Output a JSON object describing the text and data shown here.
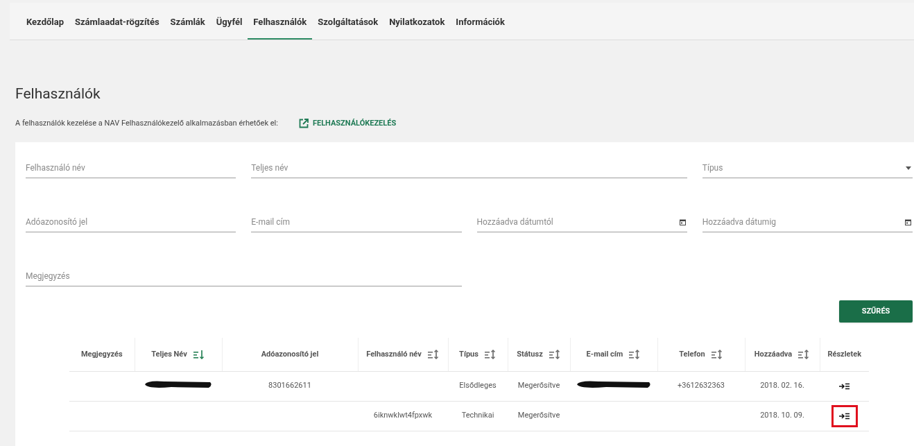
{
  "nav": [
    {
      "label": "Kezdőlap",
      "selected": false
    },
    {
      "label": "Számlaadat-rögzítés",
      "selected": false
    },
    {
      "label": "Számlák",
      "selected": false
    },
    {
      "label": "Ügyfél",
      "selected": false
    },
    {
      "label": "Felhasználók",
      "selected": true
    },
    {
      "label": "Szolgáltatások",
      "selected": false
    },
    {
      "label": "Nyilatkozatok",
      "selected": false
    },
    {
      "label": "Információk",
      "selected": false
    }
  ],
  "page_title": "Felhasználók",
  "info": {
    "text": "A felhasználók kezelése a NAV Felhasználókezelő alkalmazásban érhetőek el:",
    "link": "FELHASZNÁLÓKEZELÉS"
  },
  "filters": [
    [
      {
        "placeholder": "Felhasználó név",
        "kind": "text"
      },
      {
        "placeholder": "Teljes név",
        "kind": "text"
      },
      {
        "placeholder": "Típus",
        "kind": "select"
      }
    ],
    [
      {
        "placeholder": "Adóazonosító jel",
        "kind": "text"
      },
      {
        "placeholder": "E-mail cím",
        "kind": "text"
      },
      {
        "placeholder": "Hozzáadva dátumtól",
        "kind": "date"
      },
      {
        "placeholder": "Hozzáadva dátumig",
        "kind": "date"
      }
    ],
    [
      {
        "placeholder": "Megjegyzés",
        "kind": "text"
      }
    ]
  ],
  "filter_button": "SZŰRÉS",
  "table": {
    "columns": [
      {
        "label": "Megjegyzés",
        "sortable": false
      },
      {
        "label": "Teljes Név",
        "sortable": true,
        "sorted": true
      },
      {
        "label": "Adóazonosító jel",
        "sortable": false
      },
      {
        "label": "Felhasználó név",
        "sortable": true,
        "sorted": false
      },
      {
        "label": "Típus",
        "sortable": true,
        "sorted": false
      },
      {
        "label": "Státusz",
        "sortable": true,
        "sorted": false
      },
      {
        "label": "E-mail cím",
        "sortable": true,
        "sorted": false
      },
      {
        "label": "Telefon",
        "sortable": true,
        "sorted": false
      },
      {
        "label": "Hozzáadva",
        "sortable": true,
        "sorted": false
      },
      {
        "label": "Részletek",
        "sortable": false
      }
    ],
    "rows": [
      {
        "cells": [
          "",
          null,
          "8301662611",
          "",
          "Elsődleges",
          "Megerősítve",
          null,
          "+3612632363",
          "2018. 02. 16."
        ],
        "highlighted": false
      },
      {
        "cells": [
          "",
          "",
          "",
          "6iknwklwt4fpxwk",
          "Technikai",
          "Megerősítve",
          "",
          "",
          "2018. 10. 09."
        ],
        "highlighted": true
      }
    ]
  }
}
